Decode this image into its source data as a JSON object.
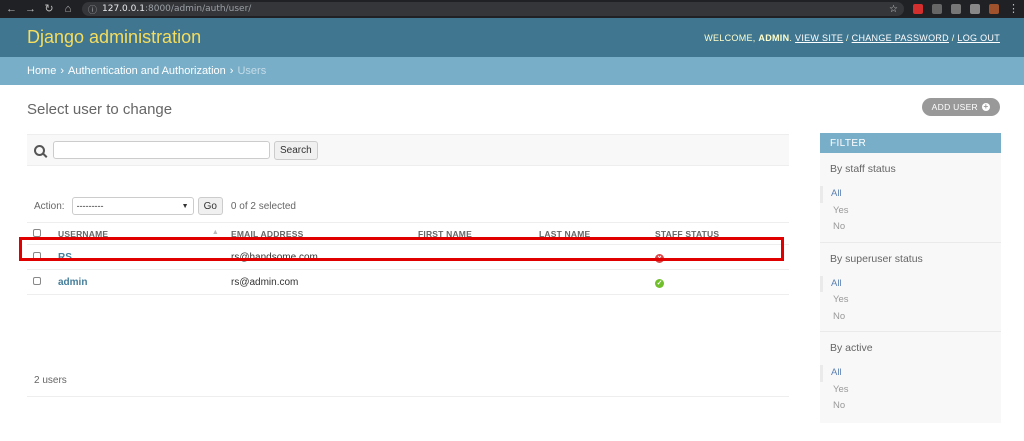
{
  "browser": {
    "url_host": "127.0.0.1",
    "url_rest": ":8000/admin/auth/user/"
  },
  "header": {
    "brand": "Django administration",
    "welcome": "WELCOME, ",
    "user": "ADMIN",
    "view_site": "VIEW SITE",
    "change_password": "CHANGE PASSWORD",
    "log_out": "LOG OUT",
    "sep": " / "
  },
  "breadcrumbs": {
    "home": "Home",
    "app": "Authentication and Authorization",
    "current": "Users",
    "sep": "›"
  },
  "page": {
    "title": "Select user to change",
    "add_button": "ADD USER"
  },
  "search": {
    "value": "",
    "button": "Search"
  },
  "actions": {
    "label": "Action:",
    "selected": "---------",
    "go": "Go",
    "counter": "0 of 2 selected"
  },
  "table": {
    "columns": [
      "USERNAME",
      "EMAIL ADDRESS",
      "FIRST NAME",
      "LAST NAME",
      "STAFF STATUS"
    ],
    "rows": [
      {
        "username": "RS",
        "email": "rs@handsome.com",
        "first_name": "",
        "last_name": "",
        "staff": "no"
      },
      {
        "username": "admin",
        "email": "rs@admin.com",
        "first_name": "",
        "last_name": "",
        "staff": "yes"
      }
    ]
  },
  "paginator": "2 users",
  "filter": {
    "title": "FILTER",
    "groups": [
      {
        "title": "By staff status",
        "options": [
          "All",
          "Yes",
          "No"
        ]
      },
      {
        "title": "By superuser status",
        "options": [
          "All",
          "Yes",
          "No"
        ]
      },
      {
        "title": "By active",
        "options": [
          "All",
          "Yes",
          "No"
        ]
      }
    ]
  },
  "colors": {
    "header_bg": "#417690",
    "brand": "#f5dd5d",
    "breadcrumbs_bg": "#79aec8",
    "link": "#447e9b",
    "highlight": "#e00000"
  }
}
